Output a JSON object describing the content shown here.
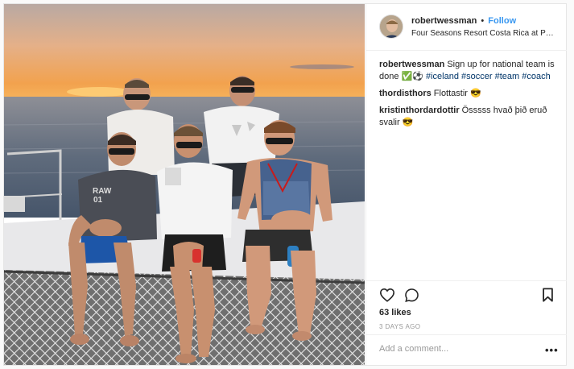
{
  "post": {
    "image_alt": "",
    "photo_text": {
      "shirt_print_1": "RAW",
      "shirt_print_2": "01"
    }
  },
  "header": {
    "username": "robertwessman",
    "separator": "•",
    "follow_label": "Follow",
    "location": "Four Seasons Resort Costa Rica at Peninsu..."
  },
  "caption": {
    "username": "robertwessman",
    "text": "Sign up for national team is done ✅⚽ ",
    "tags": [
      "#iceland",
      "#soccer",
      "#team",
      "#coach"
    ]
  },
  "comments": [
    {
      "username": "thordisthors",
      "text": "Flottastir 😎"
    },
    {
      "username": "kristinthordardottir",
      "text": "Össsss hvað þið eruð svalir 😎"
    }
  ],
  "actions": {
    "like_icon": "heart-icon",
    "comment_icon": "comment-bubble-icon",
    "save_icon": "bookmark-icon",
    "likes_text": "63 likes",
    "time_text": "3 DAYS AGO",
    "comment_placeholder": "Add a comment...",
    "more_label": "•••"
  },
  "colors": {
    "link": "#3897f0",
    "hashtag": "#003569",
    "muted": "#999999"
  }
}
